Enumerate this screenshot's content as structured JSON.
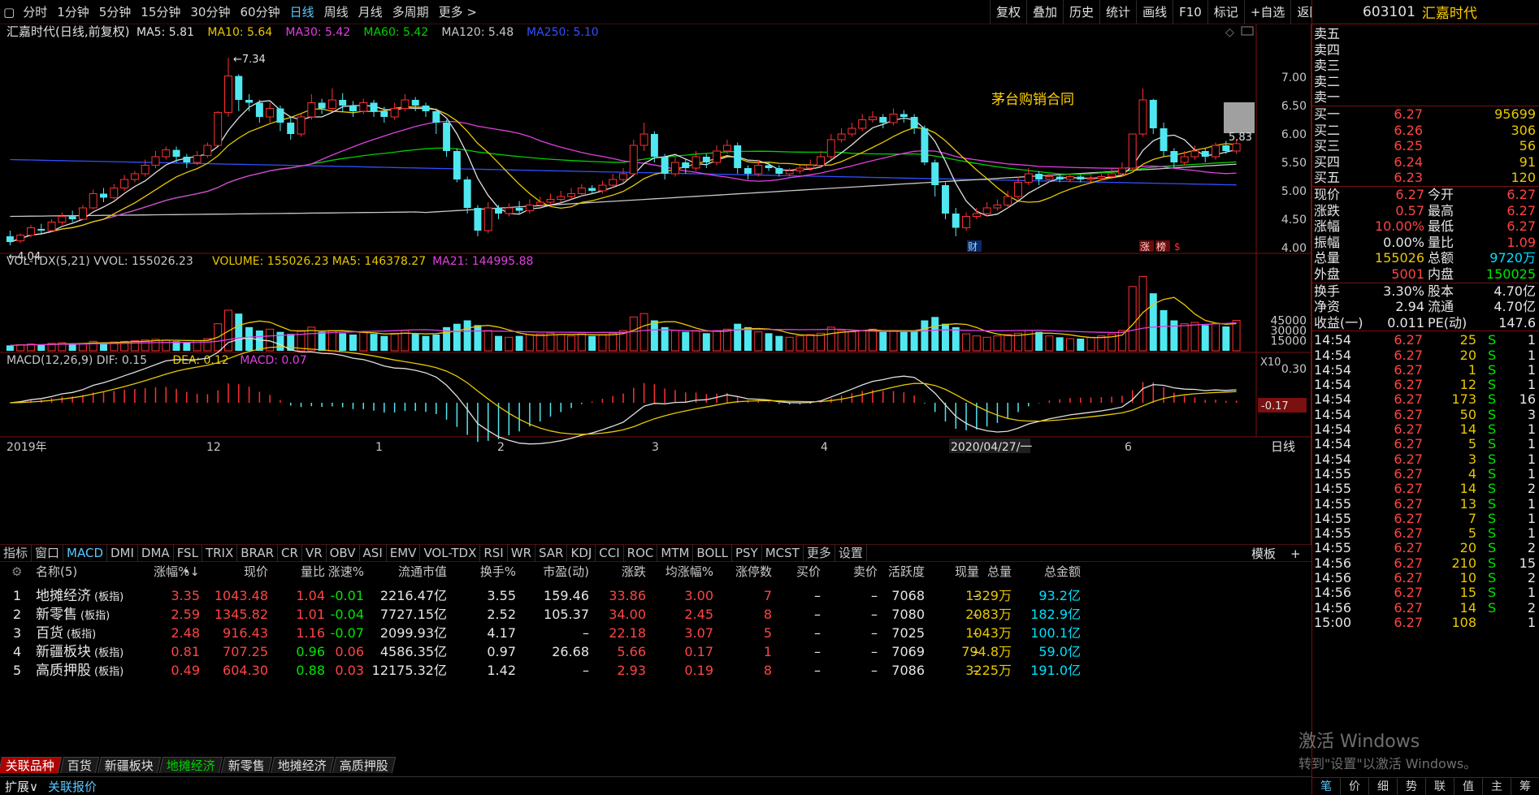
{
  "toolbar": {
    "periods": [
      "分时",
      "1分钟",
      "5分钟",
      "15分钟",
      "30分钟",
      "60分钟",
      "日线",
      "周线",
      "月线",
      "多周期",
      "更多 >"
    ],
    "active": "日线",
    "right_buttons": [
      "复权",
      "叠加",
      "历史",
      "统计",
      "画线",
      "F10",
      "标记",
      "+自选",
      "返回"
    ]
  },
  "chart": {
    "title": "汇嘉时代(日线,前复权)",
    "ma_labels": [
      {
        "text": "MA5: 5.81",
        "color": "#e0e0e0"
      },
      {
        "text": "MA10: 5.64",
        "color": "#e8c800"
      },
      {
        "text": "MA30: 5.42",
        "color": "#e040e0"
      },
      {
        "text": "MA60: 5.42",
        "color": "#00d000"
      },
      {
        "text": "MA120: 5.48",
        "color": "#c8c8c8"
      },
      {
        "text": "MA250: 5.10",
        "color": "#3050ff"
      }
    ],
    "annotation": "茅台购销合同",
    "high_label": "7.34",
    "low_label": "4.04",
    "last_price_label": "5.83",
    "y_ticks": [
      "7.00",
      "6.50",
      "6.00",
      "5.50",
      "5.00",
      "4.50",
      "4.00"
    ],
    "badges": {
      "cai": "财",
      "zhang": "涨",
      "bang": "榜",
      "s": "$"
    },
    "vol_labels": [
      {
        "text": "VOL-TDX(5,21)  VVOL: 155026.23",
        "color": "#c8c8c8"
      },
      {
        "text": "VOLUME: 155026.23",
        "color": "#e8c800"
      },
      {
        "text": "MA5: 146378.27",
        "color": "#e8c800"
      },
      {
        "text": "MA21: 144995.88",
        "color": "#e040e0"
      }
    ],
    "vol_ticks": [
      "45000",
      "30000",
      "15000"
    ],
    "vol_unit": "X10",
    "macd_labels": [
      {
        "text": "MACD(12,26,9)  DIF: 0.15",
        "color": "#c8c8c8"
      },
      {
        "text": "DEA: 0.12",
        "color": "#e8c800"
      },
      {
        "text": "MACD: 0.07",
        "color": "#e040e0"
      }
    ],
    "macd_ticks": [
      "0.30"
    ],
    "macd_cursor": "-0.17",
    "x_labels": [
      "2019年",
      "12",
      "1",
      "2",
      "3",
      "4",
      "2020/04/27/一",
      "6"
    ],
    "period_label": "日线"
  },
  "chart_data": {
    "type": "candlestick",
    "title": "汇嘉时代(日线,前复权)",
    "ylim": [
      3.9,
      7.5
    ],
    "candles": [
      [
        4.2,
        4.1,
        4.3,
        4.04
      ],
      [
        4.12,
        4.22,
        4.25,
        4.08
      ],
      [
        4.22,
        4.35,
        4.4,
        4.18
      ],
      [
        4.33,
        4.3,
        4.42,
        4.25
      ],
      [
        4.3,
        4.45,
        4.5,
        4.28
      ],
      [
        4.45,
        4.55,
        4.62,
        4.4
      ],
      [
        4.55,
        4.5,
        4.65,
        4.45
      ],
      [
        4.5,
        4.7,
        4.75,
        4.48
      ],
      [
        4.7,
        4.95,
        5.02,
        4.68
      ],
      [
        4.95,
        4.88,
        5.05,
        4.8
      ],
      [
        4.88,
        5.05,
        5.12,
        4.85
      ],
      [
        5.05,
        5.2,
        5.28,
        5.0
      ],
      [
        5.2,
        5.3,
        5.35,
        5.15
      ],
      [
        5.3,
        5.45,
        5.55,
        5.25
      ],
      [
        5.45,
        5.6,
        5.7,
        5.4
      ],
      [
        5.6,
        5.72,
        5.78,
        5.55
      ],
      [
        5.72,
        5.6,
        5.78,
        5.5
      ],
      [
        5.6,
        5.5,
        5.65,
        5.4
      ],
      [
        5.5,
        5.62,
        5.7,
        5.45
      ],
      [
        5.62,
        5.8,
        5.85,
        5.58
      ],
      [
        5.8,
        6.38,
        6.4,
        5.8
      ],
      [
        6.38,
        7.02,
        7.34,
        6.3
      ],
      [
        7.02,
        6.6,
        7.05,
        6.4
      ],
      [
        6.6,
        6.55,
        6.7,
        6.4
      ],
      [
        6.55,
        6.3,
        6.6,
        6.2
      ],
      [
        6.3,
        6.45,
        6.55,
        6.2
      ],
      [
        6.45,
        6.2,
        6.5,
        6.05
      ],
      [
        6.2,
        6.0,
        6.3,
        5.9
      ],
      [
        6.0,
        6.3,
        6.35,
        5.95
      ],
      [
        6.3,
        6.55,
        6.7,
        6.25
      ],
      [
        6.55,
        6.45,
        6.62,
        6.35
      ],
      [
        6.45,
        6.6,
        6.8,
        6.4
      ],
      [
        6.6,
        6.5,
        6.72,
        6.4
      ],
      [
        6.5,
        6.4,
        6.58,
        6.3
      ],
      [
        6.4,
        6.55,
        6.62,
        6.35
      ],
      [
        6.55,
        6.4,
        6.6,
        6.3
      ],
      [
        6.4,
        6.3,
        6.48,
        6.2
      ],
      [
        6.3,
        6.45,
        6.55,
        6.25
      ],
      [
        6.45,
        6.6,
        6.7,
        6.4
      ],
      [
        6.6,
        6.5,
        6.65,
        6.4
      ],
      [
        6.5,
        6.4,
        6.55,
        6.3
      ],
      [
        6.4,
        6.2,
        6.45,
        6.0
      ],
      [
        6.2,
        5.7,
        6.25,
        5.6
      ],
      [
        5.7,
        5.2,
        5.75,
        5.15
      ],
      [
        5.2,
        4.7,
        5.25,
        4.6
      ],
      [
        4.7,
        4.3,
        4.75,
        4.2
      ],
      [
        4.3,
        4.7,
        4.8,
        4.25
      ],
      [
        4.7,
        4.6,
        4.75,
        4.5
      ],
      [
        4.6,
        4.7,
        4.78,
        4.55
      ],
      [
        4.7,
        4.65,
        4.82,
        4.58
      ],
      [
        4.65,
        4.75,
        4.85,
        4.6
      ],
      [
        4.75,
        4.8,
        4.9,
        4.7
      ],
      [
        4.8,
        4.85,
        4.95,
        4.75
      ],
      [
        4.85,
        4.9,
        5.0,
        4.8
      ],
      [
        4.9,
        4.95,
        5.05,
        4.85
      ],
      [
        4.95,
        5.05,
        5.12,
        4.9
      ],
      [
        5.05,
        5.0,
        5.1,
        4.95
      ],
      [
        5.0,
        5.1,
        5.18,
        4.95
      ],
      [
        5.1,
        5.2,
        5.3,
        5.05
      ],
      [
        5.2,
        5.3,
        5.4,
        5.15
      ],
      [
        5.3,
        5.8,
        5.9,
        5.25
      ],
      [
        5.8,
        6.0,
        6.2,
        5.7
      ],
      [
        6.0,
        5.6,
        6.05,
        5.5
      ],
      [
        5.6,
        5.3,
        5.65,
        5.2
      ],
      [
        5.3,
        5.5,
        5.6,
        5.25
      ],
      [
        5.5,
        5.4,
        5.55,
        5.3
      ],
      [
        5.4,
        5.6,
        5.7,
        5.35
      ],
      [
        5.6,
        5.5,
        5.65,
        5.4
      ],
      [
        5.5,
        5.7,
        5.8,
        5.45
      ],
      [
        5.7,
        5.8,
        5.9,
        5.65
      ],
      [
        5.8,
        5.4,
        5.85,
        5.3
      ],
      [
        5.4,
        5.3,
        5.45,
        5.2
      ],
      [
        5.3,
        5.45,
        5.55,
        5.25
      ],
      [
        5.45,
        5.4,
        5.5,
        5.35
      ],
      [
        5.4,
        5.3,
        5.45,
        5.25
      ],
      [
        5.3,
        5.35,
        5.4,
        5.25
      ],
      [
        5.35,
        5.4,
        5.45,
        5.3
      ],
      [
        5.4,
        5.45,
        5.55,
        5.35
      ],
      [
        5.45,
        5.6,
        5.7,
        5.4
      ],
      [
        5.6,
        5.9,
        6.0,
        5.55
      ],
      [
        5.9,
        6.0,
        6.1,
        5.85
      ],
      [
        6.0,
        6.1,
        6.2,
        5.95
      ],
      [
        6.1,
        6.25,
        6.35,
        6.05
      ],
      [
        6.25,
        6.3,
        6.4,
        6.2
      ],
      [
        6.3,
        6.2,
        6.35,
        6.1
      ],
      [
        6.2,
        6.35,
        6.45,
        6.15
      ],
      [
        6.35,
        6.3,
        6.42,
        6.2
      ],
      [
        6.3,
        6.1,
        6.35,
        6.0
      ],
      [
        6.1,
        5.5,
        6.15,
        5.45
      ],
      [
        5.5,
        5.1,
        5.55,
        4.9
      ],
      [
        5.1,
        4.6,
        5.15,
        4.5
      ],
      [
        4.6,
        4.35,
        4.7,
        4.2
      ],
      [
        4.35,
        4.55,
        4.62,
        4.3
      ],
      [
        4.55,
        4.6,
        4.7,
        4.5
      ],
      [
        4.6,
        4.7,
        4.8,
        4.55
      ],
      [
        4.7,
        4.75,
        4.85,
        4.65
      ],
      [
        4.75,
        4.9,
        5.0,
        4.7
      ],
      [
        4.9,
        5.15,
        5.25,
        4.85
      ],
      [
        5.15,
        5.3,
        5.4,
        5.1
      ],
      [
        5.3,
        5.2,
        5.35,
        5.1
      ],
      [
        5.2,
        5.25,
        5.3,
        5.15
      ],
      [
        5.25,
        5.2,
        5.3,
        5.15
      ],
      [
        5.2,
        5.25,
        5.3,
        5.15
      ],
      [
        5.25,
        5.2,
        5.28,
        5.15
      ],
      [
        5.2,
        5.22,
        5.28,
        5.15
      ],
      [
        5.22,
        5.25,
        5.3,
        5.18
      ],
      [
        5.25,
        5.3,
        5.4,
        5.2
      ],
      [
        5.3,
        5.4,
        5.5,
        5.25
      ],
      [
        5.4,
        6.0,
        6.0,
        5.35
      ],
      [
        6.0,
        6.6,
        6.8,
        5.95
      ],
      [
        6.6,
        6.1,
        6.62,
        6.0
      ],
      [
        6.1,
        5.7,
        6.2,
        5.6
      ],
      [
        5.7,
        5.5,
        5.75,
        5.4
      ],
      [
        5.5,
        5.6,
        5.7,
        5.45
      ],
      [
        5.6,
        5.7,
        5.8,
        5.55
      ],
      [
        5.7,
        5.6,
        5.75,
        5.5
      ],
      [
        5.6,
        5.8,
        5.85,
        5.55
      ],
      [
        5.8,
        5.7,
        5.88,
        5.65
      ],
      [
        5.7,
        5.83,
        5.9,
        5.65
      ]
    ],
    "series": [
      {
        "name": "MA5",
        "values": [
          5.81
        ]
      },
      {
        "name": "MA10",
        "values": [
          5.64
        ]
      },
      {
        "name": "MA30",
        "values": [
          5.42
        ]
      },
      {
        "name": "MA60",
        "values": [
          5.42
        ]
      },
      {
        "name": "MA120",
        "values": [
          5.48
        ]
      },
      {
        "name": "MA250",
        "values": [
          5.1
        ]
      }
    ],
    "volume": [
      8,
      9,
      10,
      9,
      11,
      12,
      10,
      11,
      14,
      12,
      13,
      14,
      15,
      16,
      17,
      16,
      14,
      13,
      15,
      18,
      40,
      60,
      55,
      35,
      30,
      32,
      28,
      25,
      30,
      35,
      28,
      30,
      26,
      24,
      28,
      25,
      22,
      26,
      30,
      25,
      22,
      24,
      35,
      40,
      45,
      38,
      30,
      22,
      20,
      22,
      24,
      25,
      26,
      24,
      22,
      25,
      22,
      24,
      26,
      30,
      50,
      55,
      45,
      35,
      30,
      28,
      30,
      26,
      30,
      32,
      40,
      35,
      28,
      26,
      22,
      20,
      22,
      24,
      26,
      35,
      30,
      28,
      30,
      32,
      28,
      30,
      28,
      30,
      45,
      50,
      40,
      35,
      25,
      22,
      20,
      22,
      24,
      26,
      30,
      28,
      22,
      20,
      18,
      18,
      20,
      22,
      25,
      30,
      95,
      110,
      85,
      60,
      45,
      40,
      42,
      38,
      40,
      36,
      45
    ]
  },
  "side": {
    "code": "603101",
    "name": "汇嘉时代",
    "asks": [
      {
        "label": "卖五"
      },
      {
        "label": "卖四"
      },
      {
        "label": "卖三"
      },
      {
        "label": "卖二"
      },
      {
        "label": "卖一"
      }
    ],
    "bids": [
      {
        "label": "买一",
        "price": "6.27",
        "vol": "95699"
      },
      {
        "label": "买二",
        "price": "6.26",
        "vol": "306"
      },
      {
        "label": "买三",
        "price": "6.25",
        "vol": "56"
      },
      {
        "label": "买四",
        "price": "6.24",
        "vol": "91"
      },
      {
        "label": "买五",
        "price": "6.23",
        "vol": "120"
      }
    ],
    "quote": [
      {
        "l1": "现价",
        "v1": "6.27",
        "c1": "red",
        "l2": "今开",
        "v2": "6.27",
        "c2": "red"
      },
      {
        "l1": "涨跌",
        "v1": "0.57",
        "c1": "red",
        "l2": "最高",
        "v2": "6.27",
        "c2": "red"
      },
      {
        "l1": "涨幅",
        "v1": "10.00%",
        "c1": "red",
        "l2": "最低",
        "v2": "6.27",
        "c2": "red"
      },
      {
        "l1": "振幅",
        "v1": "0.00%",
        "c1": "white",
        "l2": "量比",
        "v2": "1.09",
        "c2": "red"
      },
      {
        "l1": "总量",
        "v1": "155026",
        "c1": "yellow",
        "l2": "总额",
        "v2": "9720万",
        "c2": "cyan"
      },
      {
        "l1": "外盘",
        "v1": "5001",
        "c1": "red",
        "l2": "内盘",
        "v2": "150025",
        "c2": "green"
      }
    ],
    "fund": [
      {
        "l1": "换手",
        "v1": "3.30%",
        "l2": "股本",
        "v2": "4.70亿"
      },
      {
        "l1": "净资",
        "v1": "2.94",
        "l2": "流通",
        "v2": "4.70亿"
      },
      {
        "l1": "收益(一)",
        "v1": "0.011",
        "l2": "PE(动)",
        "v2": "147.6"
      }
    ],
    "ticks": [
      {
        "t": "14:54",
        "p": "6.27",
        "v": "25",
        "s": "S",
        "n": "1"
      },
      {
        "t": "14:54",
        "p": "6.27",
        "v": "20",
        "s": "S",
        "n": "1"
      },
      {
        "t": "14:54",
        "p": "6.27",
        "v": "1",
        "s": "S",
        "n": "1"
      },
      {
        "t": "14:54",
        "p": "6.27",
        "v": "12",
        "s": "S",
        "n": "1"
      },
      {
        "t": "14:54",
        "p": "6.27",
        "v": "173",
        "s": "S",
        "n": "16"
      },
      {
        "t": "14:54",
        "p": "6.27",
        "v": "50",
        "s": "S",
        "n": "3"
      },
      {
        "t": "14:54",
        "p": "6.27",
        "v": "14",
        "s": "S",
        "n": "1"
      },
      {
        "t": "14:54",
        "p": "6.27",
        "v": "5",
        "s": "S",
        "n": "1"
      },
      {
        "t": "14:54",
        "p": "6.27",
        "v": "3",
        "s": "S",
        "n": "1"
      },
      {
        "t": "14:55",
        "p": "6.27",
        "v": "4",
        "s": "S",
        "n": "1"
      },
      {
        "t": "14:55",
        "p": "6.27",
        "v": "14",
        "s": "S",
        "n": "2"
      },
      {
        "t": "14:55",
        "p": "6.27",
        "v": "13",
        "s": "S",
        "n": "1"
      },
      {
        "t": "14:55",
        "p": "6.27",
        "v": "7",
        "s": "S",
        "n": "1"
      },
      {
        "t": "14:55",
        "p": "6.27",
        "v": "5",
        "s": "S",
        "n": "1"
      },
      {
        "t": "14:55",
        "p": "6.27",
        "v": "20",
        "s": "S",
        "n": "2"
      },
      {
        "t": "14:56",
        "p": "6.27",
        "v": "210",
        "s": "S",
        "n": "15"
      },
      {
        "t": "14:56",
        "p": "6.27",
        "v": "10",
        "s": "S",
        "n": "2"
      },
      {
        "t": "14:56",
        "p": "6.27",
        "v": "15",
        "s": "S",
        "n": "1"
      },
      {
        "t": "14:56",
        "p": "6.27",
        "v": "14",
        "s": "S",
        "n": "2"
      },
      {
        "t": "15:00",
        "p": "6.27",
        "v": "108",
        "s": "",
        "n": "1"
      }
    ],
    "bottom_tabs": [
      "笔",
      "价",
      "细",
      "势",
      "联",
      "值",
      "主",
      "筹"
    ]
  },
  "indicator_tabs": [
    "指标",
    "窗口",
    "MACD",
    "DMI",
    "DMA",
    "FSL",
    "TRIX",
    "BRAR",
    "CR",
    "VR",
    "OBV",
    "ASI",
    "EMV",
    "VOL-TDX",
    "RSI",
    "WR",
    "SAR",
    "KDJ",
    "CCI",
    "ROC",
    "MTM",
    "BOLL",
    "PSY",
    "MCST",
    "更多",
    "设置"
  ],
  "indicator_active": "MACD",
  "template_label": "模板",
  "table": {
    "headers": [
      "名称(5)",
      "•",
      "涨幅%↓",
      "现价",
      "量比",
      "涨速%",
      "流通市值",
      "换手%",
      "市盈(动)",
      "涨跌",
      "均涨幅%",
      "涨停数",
      "买价",
      "卖价",
      "活跃度",
      "现量",
      "总量",
      "总金额"
    ],
    "rows": [
      {
        "idx": "1",
        "name": "地摊经济",
        "tag": "(板指)",
        "chg": "3.35",
        "price": "1043.48",
        "lb": "1.04",
        "speed": "-0.01",
        "cap": "2216.47亿",
        "turn": "3.55",
        "pe": "159.46",
        "diff": "33.86",
        "avg": "3.00",
        "limit": "7",
        "bid": "–",
        "ask": "–",
        "act": "7068",
        "cur": "–",
        "vol": "1329万",
        "amt": "93.2亿"
      },
      {
        "idx": "2",
        "name": "新零售",
        "tag": "(板指)",
        "chg": "2.59",
        "price": "1345.82",
        "lb": "1.01",
        "speed": "-0.04",
        "cap": "7727.15亿",
        "turn": "2.52",
        "pe": "105.37",
        "diff": "34.00",
        "avg": "2.45",
        "limit": "8",
        "bid": "–",
        "ask": "–",
        "act": "7080",
        "cur": "–",
        "vol": "2083万",
        "amt": "182.9亿"
      },
      {
        "idx": "3",
        "name": "百货",
        "tag": "(板指)",
        "chg": "2.48",
        "price": "916.43",
        "lb": "1.16",
        "speed": "-0.07",
        "cap": "2099.93亿",
        "turn": "4.17",
        "pe": "–",
        "diff": "22.18",
        "avg": "3.07",
        "limit": "5",
        "bid": "–",
        "ask": "–",
        "act": "7025",
        "cur": "–",
        "vol": "1043万",
        "amt": "100.1亿"
      },
      {
        "idx": "4",
        "name": "新疆板块",
        "tag": "(板指)",
        "chg": "0.81",
        "price": "707.25",
        "lb": "0.96",
        "speed": "0.06",
        "cap": "4586.35亿",
        "turn": "0.97",
        "pe": "26.68",
        "diff": "5.66",
        "avg": "0.17",
        "limit": "1",
        "bid": "–",
        "ask": "–",
        "act": "7069",
        "cur": "–",
        "vol": "794.8万",
        "amt": "59.0亿"
      },
      {
        "idx": "5",
        "name": "高质押股",
        "tag": "(板指)",
        "chg": "0.49",
        "price": "604.30",
        "lb": "0.88",
        "speed": "0.03",
        "cap": "12175.32亿",
        "turn": "1.42",
        "pe": "–",
        "diff": "2.93",
        "avg": "0.19",
        "limit": "8",
        "bid": "–",
        "ask": "–",
        "act": "7086",
        "cur": "–",
        "vol": "3225万",
        "amt": "191.0亿"
      }
    ]
  },
  "block_tabs": [
    "关联品种",
    "百货",
    "新疆板块",
    "地摊经济",
    "新零售",
    "地摊经济",
    "高质押股"
  ],
  "expand": [
    "扩展∨",
    "关联报价"
  ],
  "watermark": {
    "line1": "激活 Windows",
    "line2": "转到\"设置\"以激活 Windows。"
  }
}
